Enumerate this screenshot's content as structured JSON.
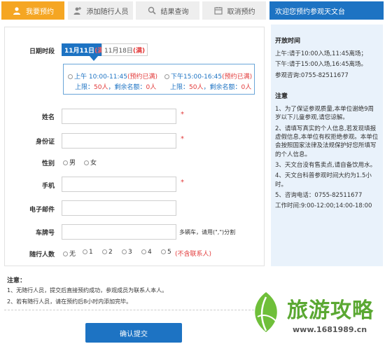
{
  "tabs": [
    {
      "label": "我要预约",
      "icon": "user-icon"
    },
    {
      "label": "添加随行人员",
      "icon": "user-add-icon"
    },
    {
      "label": "结果查询",
      "icon": "search-icon"
    },
    {
      "label": "取消预约",
      "icon": "calendar-icon"
    }
  ],
  "info_header": "欢迎您预约参观天文台",
  "form": {
    "date_label": "日期时段",
    "dates": [
      {
        "date": "11月11日",
        "status": "(满)"
      },
      {
        "date": "11月18日",
        "status": "(满)"
      }
    ],
    "slots": [
      {
        "time": "上午 10:00-11:45",
        "status": "(预约已满)",
        "limit_label": "上限：",
        "limit": "50人",
        "remain_label": "，剩余名额：",
        "remain": "0人"
      },
      {
        "time": "下午15:00-16:45",
        "status": "(预约已满)",
        "limit_label": "上限：",
        "limit": "50人",
        "remain_label": "，剩余名额：",
        "remain": "0人"
      }
    ],
    "name_label": "姓名",
    "id_label": "身份证",
    "gender_label": "性别",
    "gender_options": [
      "男",
      "女"
    ],
    "phone_label": "手机",
    "email_label": "电子邮件",
    "plate_label": "车牌号",
    "plate_hint": "多辆车，请用(\",\")分割",
    "companions_label": "随行人数",
    "companions_options": [
      "无",
      "1",
      "2",
      "3",
      "4",
      "5"
    ],
    "companions_note": "(不含联系人)",
    "required_mark": "*"
  },
  "notes": {
    "title": "注意：",
    "items": [
      "1、无随行人员，提交后直接预约成功，参观成员为联系人本人。",
      "2、若有随行人员，请在预约后8小时内添加完毕。"
    ]
  },
  "submit_label": "确认提交",
  "info": {
    "hours_title": "开放时间",
    "hours": [
      "上午:请于10:00入场,11:45离场；",
      "下午:请于15:00入场,16:45离场。",
      "参观咨询:0755-82511677"
    ],
    "notice_title": "注意",
    "notices": [
      "1、为了保证参观质量,本单位谢绝9周岁以下儿童参观,请您谅解。",
      "2、请填写真实的个人信息,若发现填报虚假信息,本单位有权拒绝参观。本单位会按照国家法律及法规保护好您所填写的个人信息。",
      "3、天文台没有售卖点,请自备饮用水。",
      "4、天文台科普参观时间大约为1.5小时。",
      "5、咨询电话：0755-82511677",
      "工作时间:9:00-12:00;14:00-18:00"
    ]
  },
  "watermark": {
    "text": "旅游攻略",
    "url": "www.1681989.cn"
  },
  "colors": {
    "accent": "#f5a623",
    "primary": "#1d73c3",
    "required": "#e23b3b",
    "panel": "#e9f2fb"
  }
}
